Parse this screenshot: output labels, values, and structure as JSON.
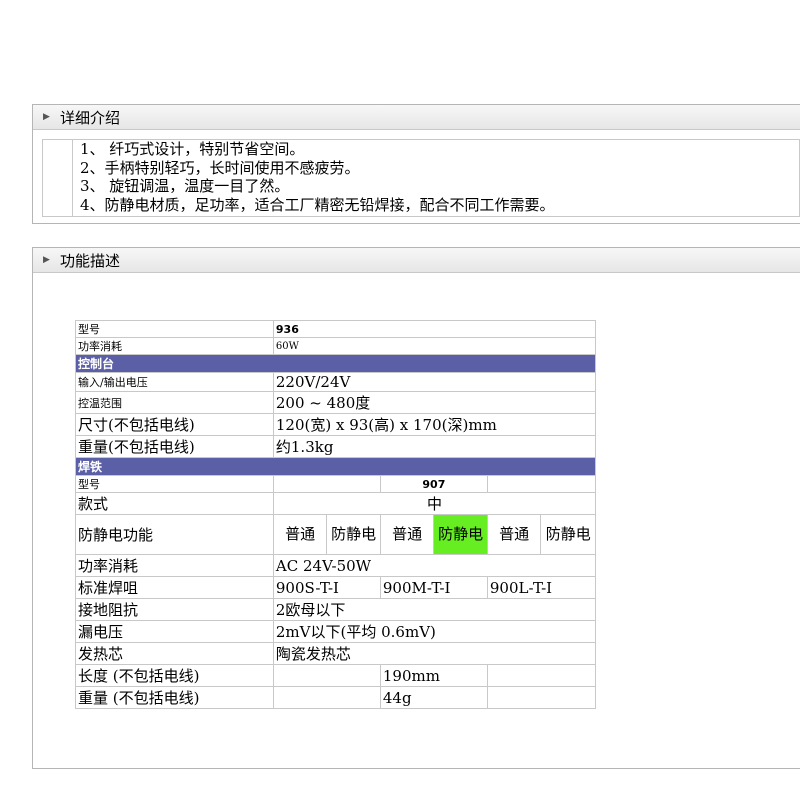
{
  "intro": {
    "header": "详细介绍",
    "lines": [
      "1、  纤巧式设计，特别节省空间。",
      "2、手柄特别轻巧，长时间使用不感疲劳。",
      "3、  旋钮调温，温度一目了然。",
      "4、防静电材质，足功率，适合工厂精密无铅焊接，配合不同工作需要。"
    ]
  },
  "func": {
    "header": "功能描述"
  },
  "table": {
    "model_label": "型号",
    "model_value": "936",
    "power_label": "功率消耗",
    "power_value": "60W",
    "section_station": "控制台",
    "io_voltage_label": "输入/输出电压",
    "io_voltage_value": "220V/24V",
    "temp_range_label": "控温范围",
    "temp_range_value": "200 ~ 480度",
    "size_label": "尺寸(不包括电线)",
    "size_value": "120(宽) x 93(高) x 170(深)mm",
    "weight_label": "重量(不包括电线)",
    "weight_value": "约1.3kg",
    "section_iron": "焊铁",
    "iron_model_label": "型号",
    "iron_model_value": "907",
    "style_label": "款式",
    "style_value": "中",
    "esd_label": "防静电功能",
    "esd_options": [
      "普通",
      "防静电",
      "普通",
      "防静电",
      "普通",
      "防静电"
    ],
    "iron_power_label": "功率消耗",
    "iron_power_value": "AC 24V-50W",
    "tips_label": "标准焊咀",
    "tips_values": [
      "900S-T-I",
      "900M-T-I",
      "900L-T-I"
    ],
    "ground_label": "接地阻抗",
    "ground_value": "2欧母以下",
    "leak_label": "漏电压",
    "leak_value": "2mV以下(平均 0.6mV)",
    "heater_label": "发热芯",
    "heater_value": "陶瓷发热芯",
    "length_label": "长度 (不包括电线)",
    "length_value": "190mm",
    "iron_weight_label": "重量 (不包括电线)",
    "iron_weight_value": "44g"
  },
  "colors": {
    "section_bg": "#5b5fa6",
    "highlight": "#66ee22"
  }
}
